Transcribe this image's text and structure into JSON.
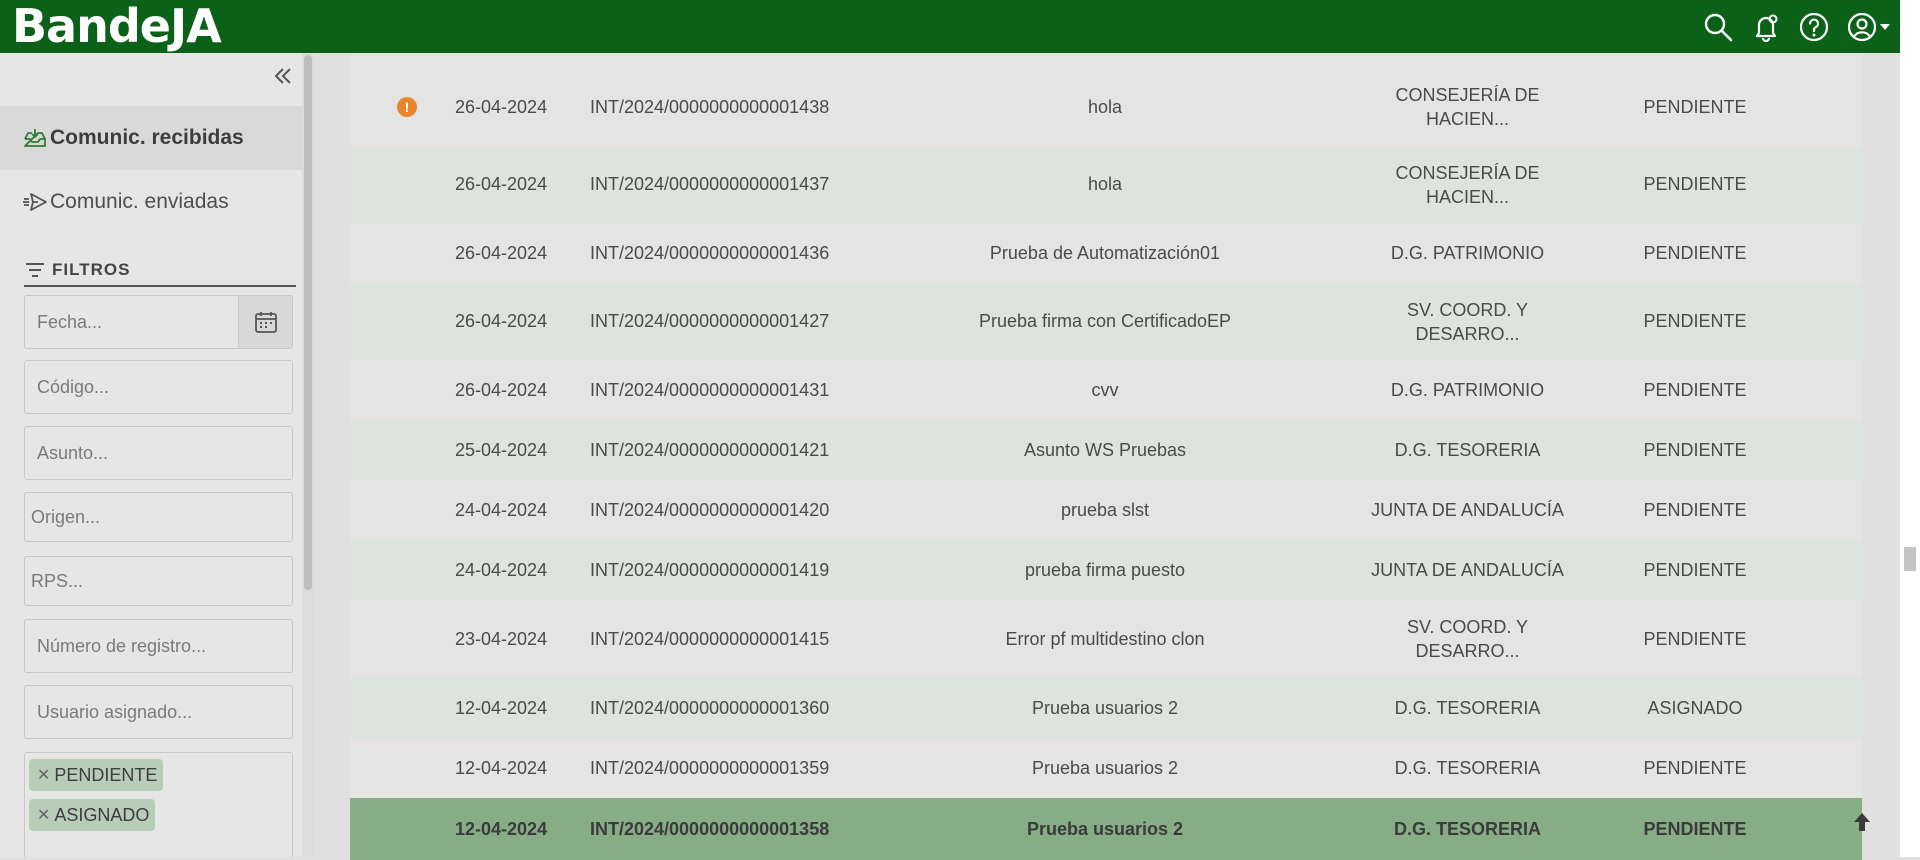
{
  "header": {
    "brand": "BandeJA",
    "colors": {
      "bar": "#0b6118",
      "icon": "#ffffff"
    },
    "icons": [
      "search-icon",
      "notification-bell-icon",
      "help-icon",
      "user-account-icon"
    ]
  },
  "sidebar": {
    "nav": [
      {
        "label": "Comunic. recibidas",
        "icon": "inbox-icon",
        "active": true
      },
      {
        "label": "Comunic. enviadas",
        "icon": "send-icon",
        "active": false
      }
    ],
    "filters_title": "FILTROS",
    "fields": {
      "fecha": "Fecha...",
      "codigo": "Código...",
      "asunto": "Asunto...",
      "origen": "Origen...",
      "rps": "RPS...",
      "numero_registro": "Número de registro...",
      "usuario_asignado": "Usuario asignado..."
    },
    "status_tags": [
      {
        "label": "PENDIENTE"
      },
      {
        "label": "ASIGNADO"
      }
    ]
  },
  "table": {
    "rows": [
      {
        "date": "26-04-2024",
        "code": "INT/2024/0000000000001438",
        "subject": "hola",
        "origin_l1": "CONSEJERÍA DE",
        "origin_l2": "HACIEN...",
        "status": "PENDIENTE",
        "warning": "!"
      },
      {
        "date": "26-04-2024",
        "code": "INT/2024/0000000000001437",
        "subject": "hola",
        "origin_l1": "CONSEJERÍA DE",
        "origin_l2": "HACIEN...",
        "status": "PENDIENTE"
      },
      {
        "date": "26-04-2024",
        "code": "INT/2024/0000000000001436",
        "subject": "Prueba de Automatización01",
        "origin_l1": "D.G. PATRIMONIO",
        "status": "PENDIENTE"
      },
      {
        "date": "26-04-2024",
        "code": "INT/2024/0000000000001427",
        "subject": "Prueba firma con CertificadoEP",
        "origin_l1": "SV. COORD. Y",
        "origin_l2": "DESARRO...",
        "status": "PENDIENTE"
      },
      {
        "date": "26-04-2024",
        "code": "INT/2024/0000000000001431",
        "subject": "cvv",
        "origin_l1": "D.G. PATRIMONIO",
        "status": "PENDIENTE"
      },
      {
        "date": "25-04-2024",
        "code": "INT/2024/0000000000001421",
        "subject": "Asunto WS Pruebas",
        "origin_l1": "D.G. TESORERIA",
        "status": "PENDIENTE"
      },
      {
        "date": "24-04-2024",
        "code": "INT/2024/0000000000001420",
        "subject": "prueba slst",
        "origin_l1": "JUNTA DE ANDALUCÍA",
        "status": "PENDIENTE"
      },
      {
        "date": "24-04-2024",
        "code": "INT/2024/0000000000001419",
        "subject": "prueba firma puesto",
        "origin_l1": "JUNTA DE ANDALUCÍA",
        "status": "PENDIENTE"
      },
      {
        "date": "23-04-2024",
        "code": "INT/2024/0000000000001415",
        "subject": "Error pf multidestino clon",
        "origin_l1": "SV. COORD. Y",
        "origin_l2": "DESARRO...",
        "status": "PENDIENTE"
      },
      {
        "date": "12-04-2024",
        "code": "INT/2024/0000000000001360",
        "subject": "Prueba usuarios 2",
        "origin_l1": "D.G. TESORERIA",
        "status": "ASIGNADO"
      },
      {
        "date": "12-04-2024",
        "code": "INT/2024/0000000000001359",
        "subject": "Prueba usuarios 2",
        "origin_l1": "D.G. TESORERIA",
        "status": "PENDIENTE"
      },
      {
        "date": "12-04-2024",
        "code": "INT/2024/0000000000001358",
        "subject": "Prueba usuarios 2",
        "origin_l1": "D.G. TESORERIA",
        "status": "PENDIENTE",
        "selected": true
      }
    ]
  }
}
